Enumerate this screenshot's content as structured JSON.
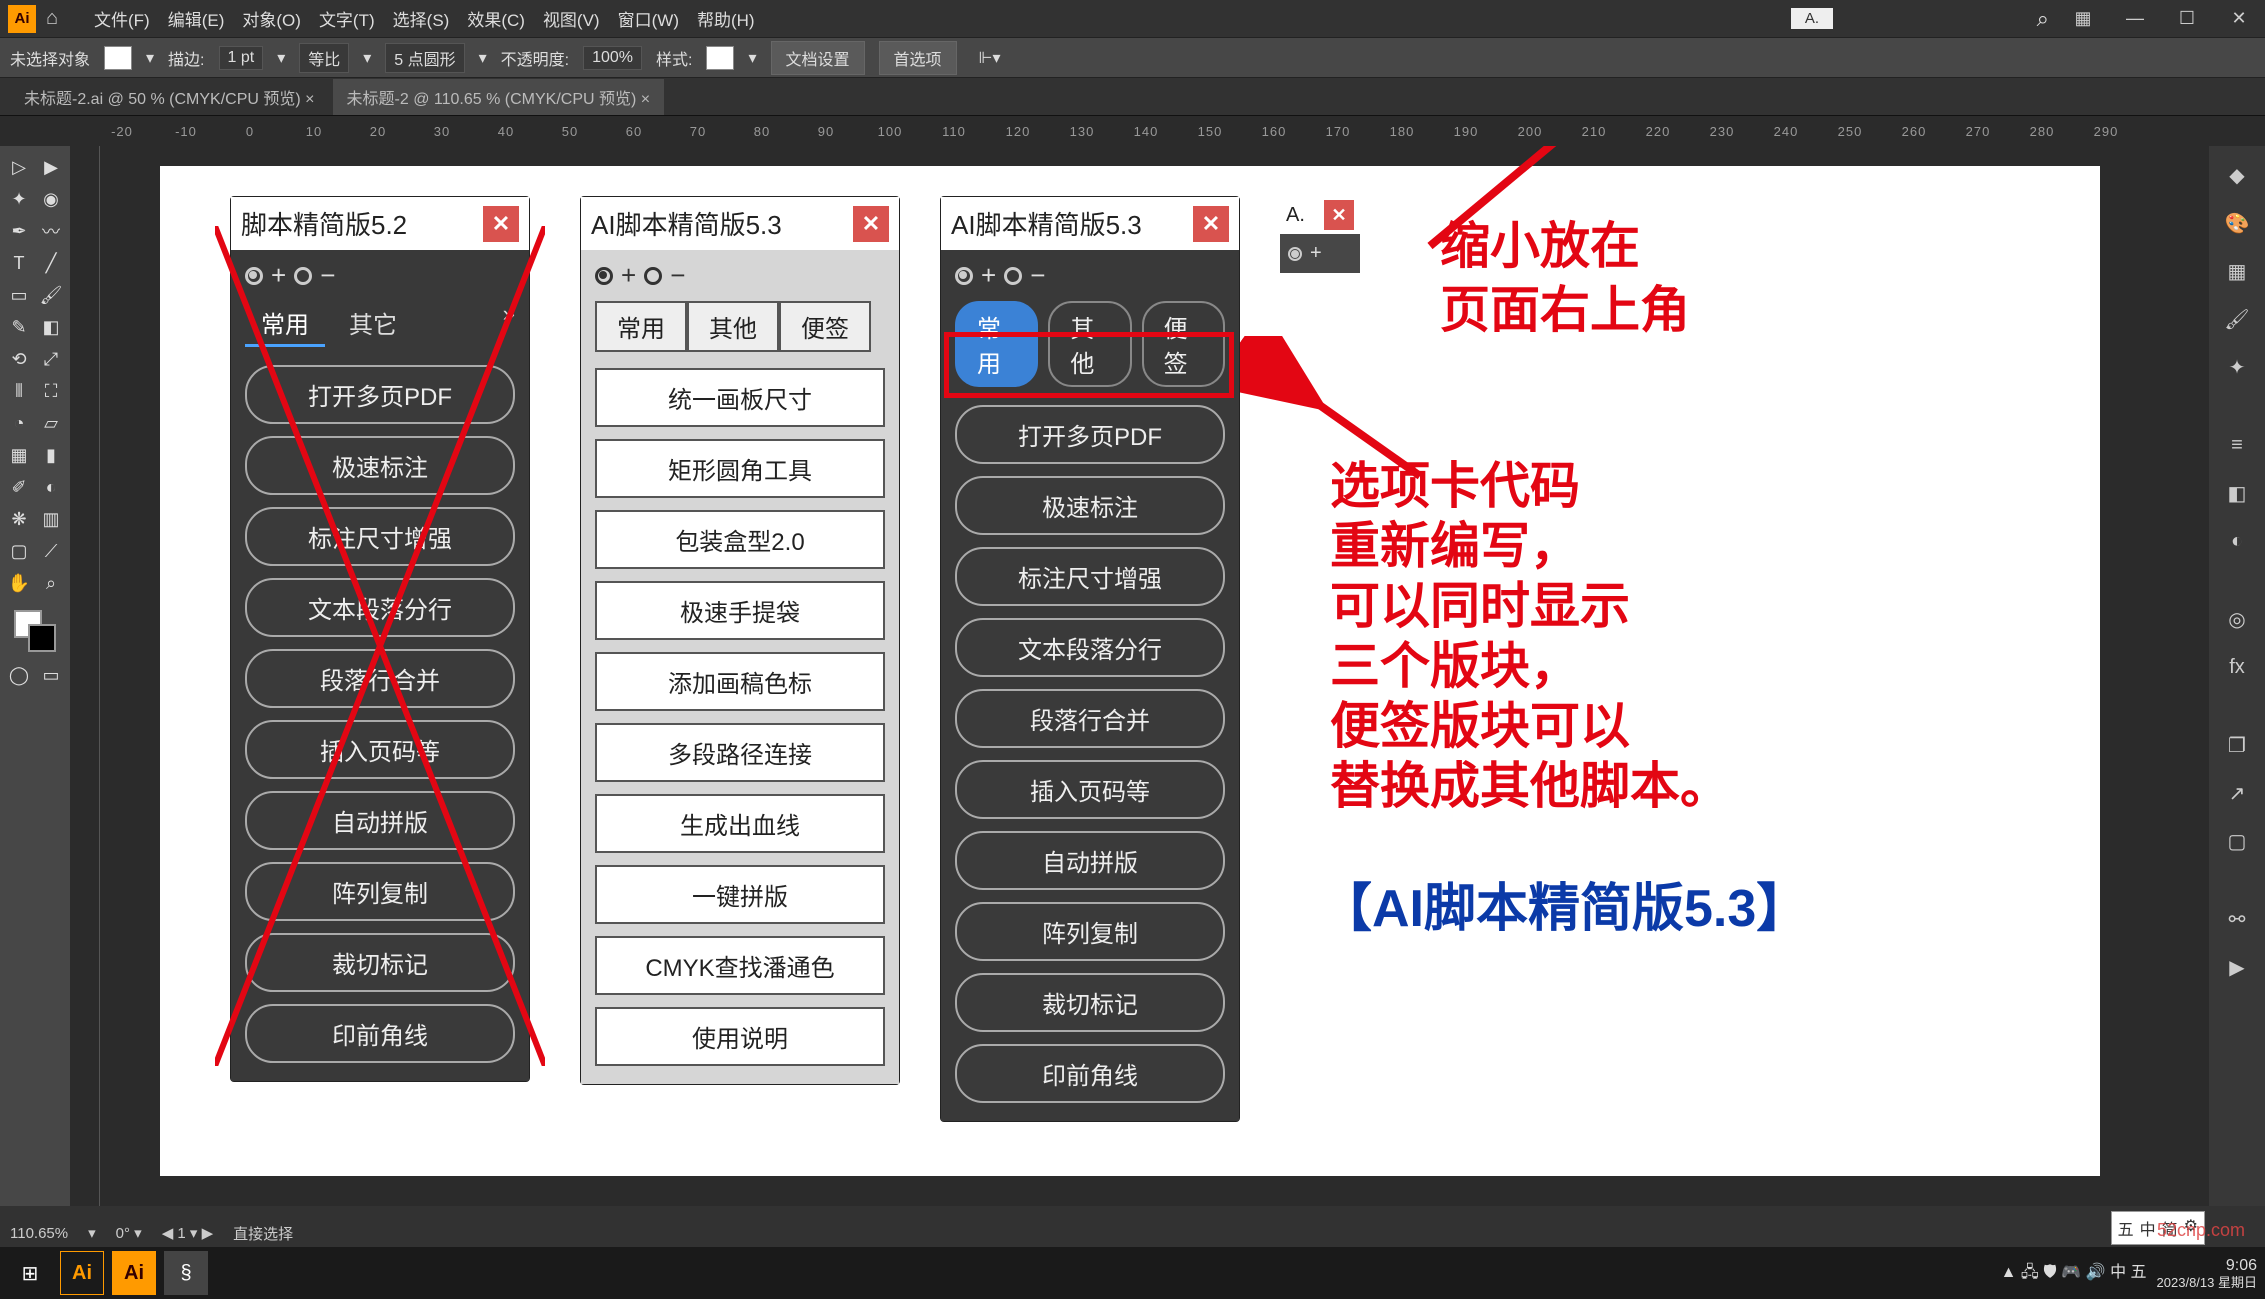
{
  "menubar": {
    "items": [
      "文件(F)",
      "编辑(E)",
      "对象(O)",
      "文字(T)",
      "选择(S)",
      "效果(C)",
      "视图(V)",
      "窗口(W)",
      "帮助(H)"
    ],
    "doc_label": "A."
  },
  "optbar": {
    "no_sel": "未选择对象",
    "stroke": "描边:",
    "stroke_val": "1 pt",
    "uniform": "等比",
    "pt5": "5 点圆形",
    "opacity": "不透明度:",
    "opacity_val": "100%",
    "style": "样式:",
    "doc_set": "文档设置",
    "prefs": "首选项"
  },
  "tabs": {
    "t1": "未标题-2.ai @ 50 % (CMYK/CPU 预览)",
    "t2": "未标题-2 @ 110.65 % (CMYK/CPU 预览)"
  },
  "ruler": [
    "-20",
    "-10",
    "0",
    "10",
    "20",
    "30",
    "40",
    "50",
    "60",
    "70",
    "80",
    "90",
    "100",
    "110",
    "120",
    "130",
    "140",
    "150",
    "160",
    "170",
    "180",
    "190",
    "200",
    "210",
    "220",
    "230",
    "240",
    "250",
    "260",
    "270",
    "280",
    "290"
  ],
  "panel_a": {
    "title": "脚本精简版5.2",
    "tabs": [
      "常用",
      "其它"
    ],
    "items": [
      "打开多页PDF",
      "极速标注",
      "标注尺寸增强",
      "文本段落分行",
      "段落行合并",
      "插入页码等",
      "自动拼版",
      "阵列复制",
      "裁切标记",
      "印前角线"
    ]
  },
  "panel_b": {
    "title": "AI脚本精简版5.3",
    "tabs": [
      "常用",
      "其他",
      "便签"
    ],
    "items": [
      "统一画板尺寸",
      "矩形圆角工具",
      "包装盒型2.0",
      "极速手提袋",
      "添加画稿色标",
      "多段路径连接",
      "生成出血线",
      "一键拼版",
      "CMYK查找潘通色",
      "使用说明"
    ]
  },
  "panel_c": {
    "title": "AI脚本精简版5.3",
    "tabs": [
      "常用",
      "其他",
      "便签"
    ],
    "items": [
      "打开多页PDF",
      "极速标注",
      "标注尺寸增强",
      "文本段落分行",
      "段落行合并",
      "插入页码等",
      "自动拼版",
      "阵列复制",
      "裁切标记",
      "印前角线"
    ]
  },
  "panel_min": {
    "title": "A."
  },
  "anno": {
    "l1": "缩小放在",
    "l2": "页面右上角",
    "p1": "选项卡代码",
    "p2": "重新编写，",
    "p3": "可以同时显示",
    "p4": "三个版块，",
    "p5": "便签版块可以",
    "p6": "替换成其他脚本。",
    "blue": "【AI脚本精简版5.3】"
  },
  "status": {
    "zoom": "110.65%",
    "sel": "直接选择"
  },
  "taskbar": {
    "time": "9:06",
    "date": "2023/8/13 星期日"
  },
  "tray": {
    "items": [
      "五",
      "中",
      "简",
      "⚙"
    ]
  },
  "watermark": "52cnp.com"
}
